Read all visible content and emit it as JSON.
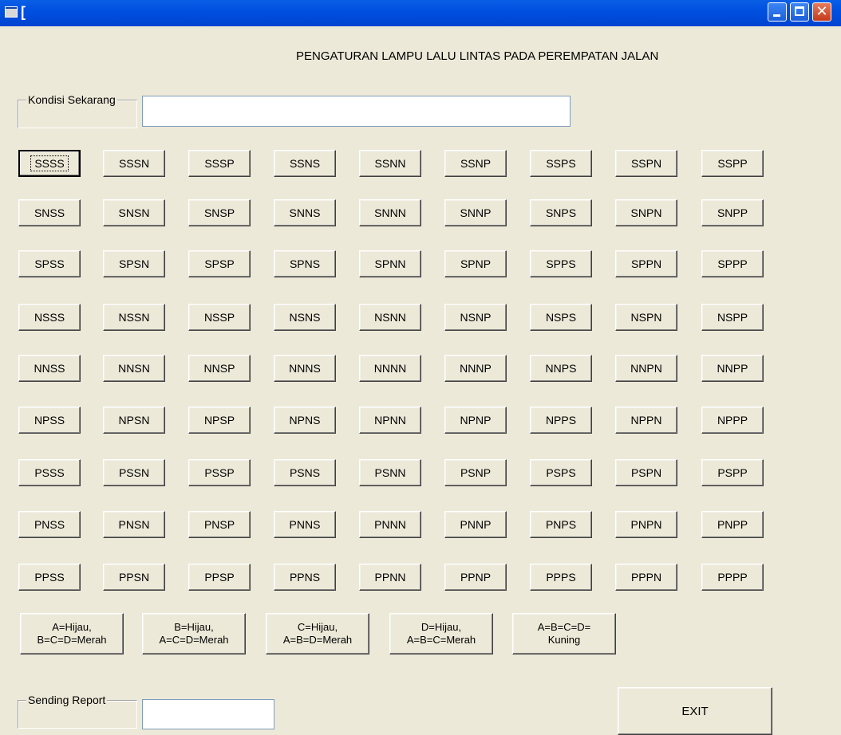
{
  "window": {
    "title": "["
  },
  "heading": "PENGATURAN LAMPU LALU LINTAS PADA PEREMPATAN JALAN",
  "kondisi": {
    "label": "Kondisi Sekarang",
    "value": ""
  },
  "grid": [
    [
      "SSSS",
      "SSSN",
      "SSSP",
      "SSNS",
      "SSNN",
      "SSNP",
      "SSPS",
      "SSPN",
      "SSPP"
    ],
    [
      "SNSS",
      "SNSN",
      "SNSP",
      "SNNS",
      "SNNN",
      "SNNP",
      "SNPS",
      "SNPN",
      "SNPP"
    ],
    [
      "SPSS",
      "SPSN",
      "SPSP",
      "SPNS",
      "SPNN",
      "SPNP",
      "SPPS",
      "SPPN",
      "SPPP"
    ],
    [
      "NSSS",
      "NSSN",
      "NSSP",
      "NSNS",
      "NSNN",
      "NSNP",
      "NSPS",
      "NSPN",
      "NSPP"
    ],
    [
      "NNSS",
      "NNSN",
      "NNSP",
      "NNNS",
      "NNNN",
      "NNNP",
      "NNPS",
      "NNPN",
      "NNPP"
    ],
    [
      "NPSS",
      "NPSN",
      "NPSP",
      "NPNS",
      "NPNN",
      "NPNP",
      "NPPS",
      "NPPN",
      "NPPP"
    ],
    [
      "PSSS",
      "PSSN",
      "PSSP",
      "PSNS",
      "PSNN",
      "PSNP",
      "PSPS",
      "PSPN",
      "PSPP"
    ],
    [
      "PNSS",
      "PNSN",
      "PNSP",
      "PNNS",
      "PNNN",
      "PNNP",
      "PNPS",
      "PNPN",
      "PNPP"
    ],
    [
      "PPSS",
      "PPSN",
      "PPSP",
      "PPNS",
      "PPNN",
      "PPNP",
      "PPPS",
      "PPPN",
      "PPPP"
    ]
  ],
  "presets": [
    "A=Hijau,\nB=C=D=Merah",
    "B=Hijau,\nA=C=D=Merah",
    "C=Hijau,\nA=B=D=Merah",
    "D=Hijau,\nA=B=C=Merah",
    "A=B=C=D=\nKuning"
  ],
  "report": {
    "label": "Sending Report",
    "value": ""
  },
  "exit_label": "EXIT"
}
